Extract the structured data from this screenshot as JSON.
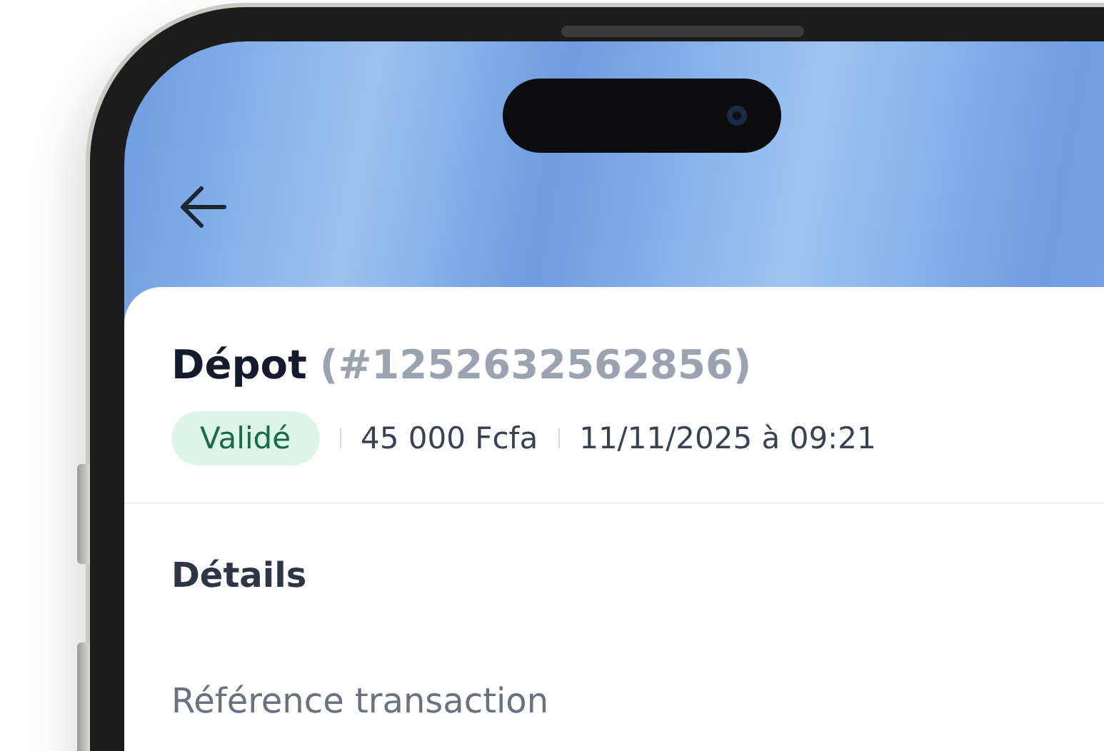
{
  "transaction": {
    "title": "Dépot",
    "id": "(#1252632562856)",
    "status": {
      "label": "Validé",
      "kind": "success"
    },
    "amount": "45 000 Fcfa",
    "date": "11/11/2025 à 09:21"
  },
  "details": {
    "heading": "Détails",
    "fields": [
      {
        "label": "Référence transaction"
      }
    ]
  }
}
